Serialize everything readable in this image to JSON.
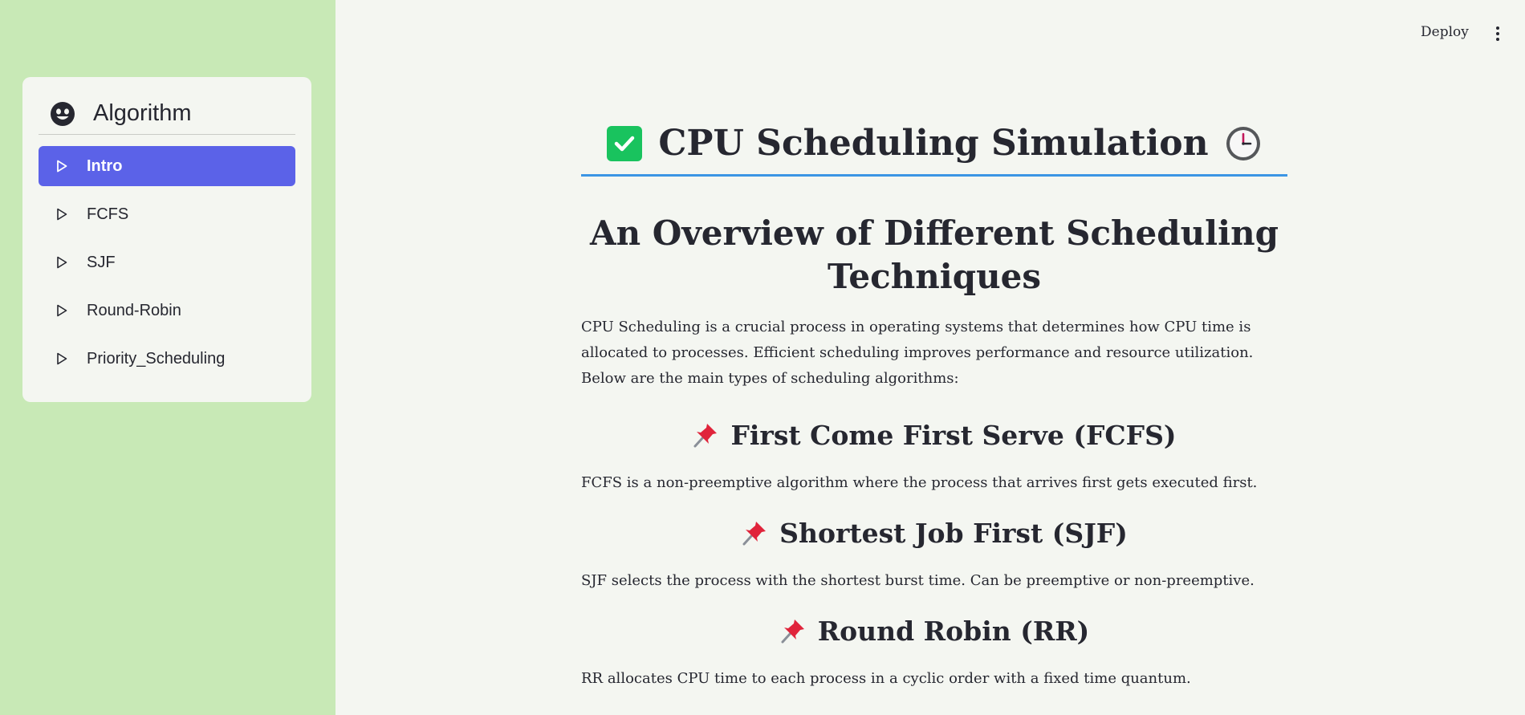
{
  "sidebar": {
    "menu_title": "Algorithm",
    "menu_icon": "smiley-face-icon",
    "items": [
      {
        "label": "Intro",
        "active": true
      },
      {
        "label": "FCFS",
        "active": false
      },
      {
        "label": "SJF",
        "active": false
      },
      {
        "label": "Round-Robin",
        "active": false
      },
      {
        "label": "Priority_Scheduling",
        "active": false
      }
    ],
    "colors": {
      "background": "#c8e9b6",
      "active": "#5b62e8"
    }
  },
  "toolbar": {
    "deploy_label": "Deploy",
    "more_icon": "vertical-dots-icon"
  },
  "main": {
    "title": "CPU Scheduling Simulation",
    "title_icons": [
      "check-mark-icon",
      "clock-icon"
    ],
    "subtitle": "An Overview of Different Scheduling Techniques",
    "intro": "CPU Scheduling is a crucial process in operating systems that determines how CPU time is allocated to processes. Efficient scheduling improves performance and resource utilization. Below are the main types of scheduling algorithms:",
    "sections": [
      {
        "heading": "First Come First Serve (FCFS)",
        "text": "FCFS is a non-preemptive algorithm where the process that arrives first gets executed first."
      },
      {
        "heading": "Shortest Job First (SJF)",
        "text": "SJF selects the process with the shortest burst time. Can be preemptive or non-preemptive."
      },
      {
        "heading": "Round Robin (RR)",
        "text": "RR allocates CPU time to each process in a cyclic order with a fixed time quantum."
      }
    ],
    "accent_color": "#3b95e4"
  }
}
